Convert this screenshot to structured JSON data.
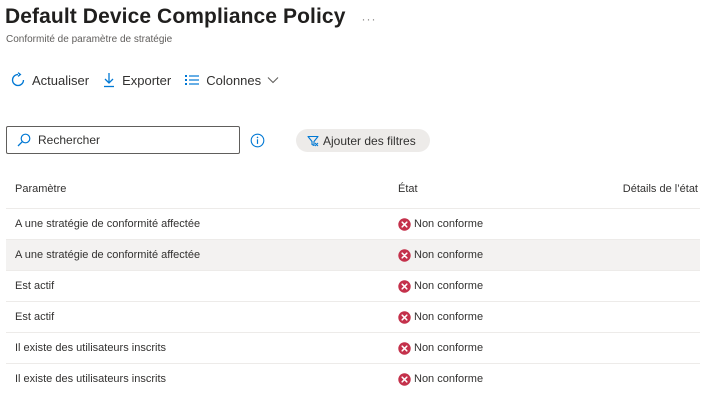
{
  "header": {
    "title": "Default Device Compliance Policy",
    "more_label": "···",
    "subtitle": "Conformité de paramètre de stratégie"
  },
  "toolbar": {
    "refresh_label": "Actualiser",
    "export_label": "Exporter",
    "columns_label": "Colonnes"
  },
  "search": {
    "placeholder": "Rechercher",
    "value": ""
  },
  "filter": {
    "label": "Ajouter des filtres"
  },
  "table": {
    "columns": [
      "Paramètre",
      "État",
      "Détails de l’état"
    ],
    "rows": [
      {
        "setting": "A une stratégie de conformité affectée",
        "status": "Non conforme",
        "details": ""
      },
      {
        "setting": "A une stratégie de conformité affectée",
        "status": "Non conforme",
        "details": ""
      },
      {
        "setting": "Est actif",
        "status": "Non conforme",
        "details": ""
      },
      {
        "setting": "Est actif",
        "status": "Non conforme",
        "details": ""
      },
      {
        "setting": "Il existe des utilisateurs inscrits",
        "status": "Non conforme",
        "details": ""
      },
      {
        "setting": "Il existe des utilisateurs inscrits",
        "status": "Non conforme",
        "details": ""
      }
    ],
    "selected_row": 1
  },
  "colors": {
    "accent": "#0078d4",
    "error": "#c4314b",
    "text": "#323130",
    "selected_row_bg": "#f3f2f1",
    "pill_bg": "#edebe9"
  },
  "icons": {
    "refresh": "refresh-icon",
    "export": "download-icon",
    "columns": "columns-icon",
    "search": "search-icon",
    "info": "info-icon",
    "filter": "filter-icon",
    "status": "error-circle-icon"
  }
}
